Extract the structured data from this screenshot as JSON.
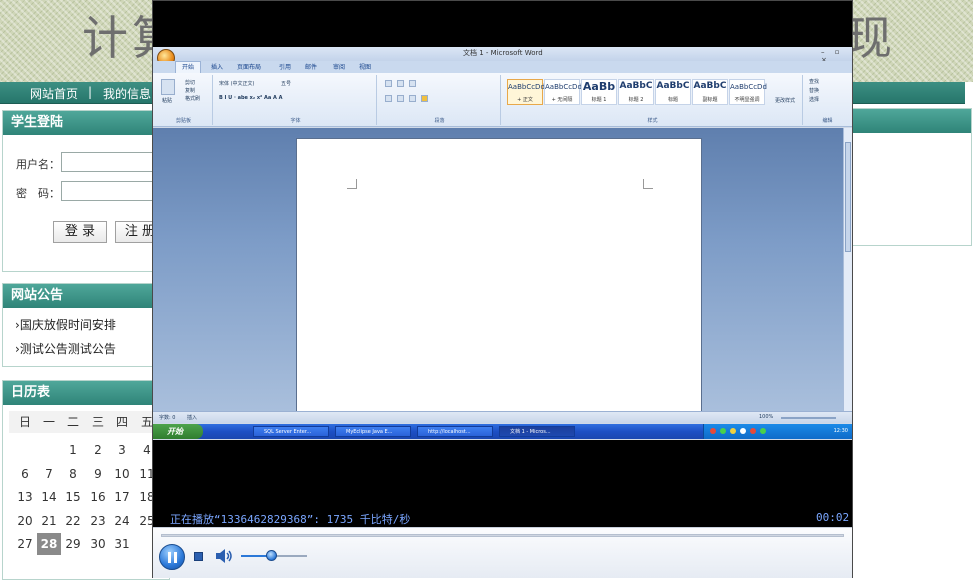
{
  "site": {
    "title_left": "计算",
    "title_right": "现",
    "nav": {
      "home": "网站首页",
      "separator": "|",
      "my_info": "我的信息"
    }
  },
  "login": {
    "title": "学生登陆",
    "username_label": "用户名：",
    "password_label": "密　码：",
    "login_button": "登 录",
    "register_button": "注 册"
  },
  "notice": {
    "title": "网站公告",
    "items": [
      "国庆放假时间安排",
      "测试公告测试公告"
    ]
  },
  "calendar": {
    "title": "日历表",
    "weekdays": [
      "日",
      "一",
      "二",
      "三",
      "四",
      "五"
    ],
    "rows": [
      [
        "",
        "",
        "1",
        "2",
        "3",
        "4"
      ],
      [
        "6",
        "7",
        "8",
        "9",
        "10",
        "11"
      ],
      [
        "13",
        "14",
        "15",
        "16",
        "17",
        "18"
      ],
      [
        "20",
        "21",
        "22",
        "23",
        "24",
        "25"
      ],
      [
        "27",
        "28",
        "29",
        "30",
        "31",
        ""
      ]
    ],
    "today": "28"
  },
  "player": {
    "now_playing": "正在播放“1336462829368”: 1735 千比特/秒",
    "elapsed": "00:02",
    "volume": 0.45,
    "word": {
      "title": "文档 1 - Microsoft Word",
      "tabs": [
        "开始",
        "插入",
        "页面布局",
        "引用",
        "邮件",
        "审阅",
        "视图"
      ],
      "groups": [
        "剪贴板",
        "字体",
        "段落",
        "样式",
        "编辑"
      ],
      "clipboard": {
        "paste": "粘贴",
        "cut": "剪切",
        "copy": "复制",
        "format_painter": "格式刷"
      },
      "font_name": "宋体 (中文正文)",
      "font_size": "五号",
      "styles": [
        {
          "sample": "AaBbCcDd",
          "name": "+ 正文"
        },
        {
          "sample": "AaBbCcDd",
          "name": "+ 无间隔"
        },
        {
          "sample": "AaBb",
          "name": "标题 1"
        },
        {
          "sample": "AaBbC",
          "name": "标题 2"
        },
        {
          "sample": "AaBbC",
          "name": "标题"
        },
        {
          "sample": "AaBbC",
          "name": "副标题"
        },
        {
          "sample": "AaBbCcDd",
          "name": "不明显强调"
        }
      ],
      "change_styles": "更改样式",
      "editing": {
        "find": "查找",
        "replace": "替换",
        "select": "选择"
      },
      "status_page": "字数: 0",
      "status_mode": "插入",
      "zoom": "100%"
    },
    "taskbar": {
      "start": "开始",
      "items": [
        "SQL Server Enter...",
        "MyEclipse Java E...",
        "http://localhost...",
        "文档 1 - Micros..."
      ],
      "clock": "12:30"
    }
  }
}
